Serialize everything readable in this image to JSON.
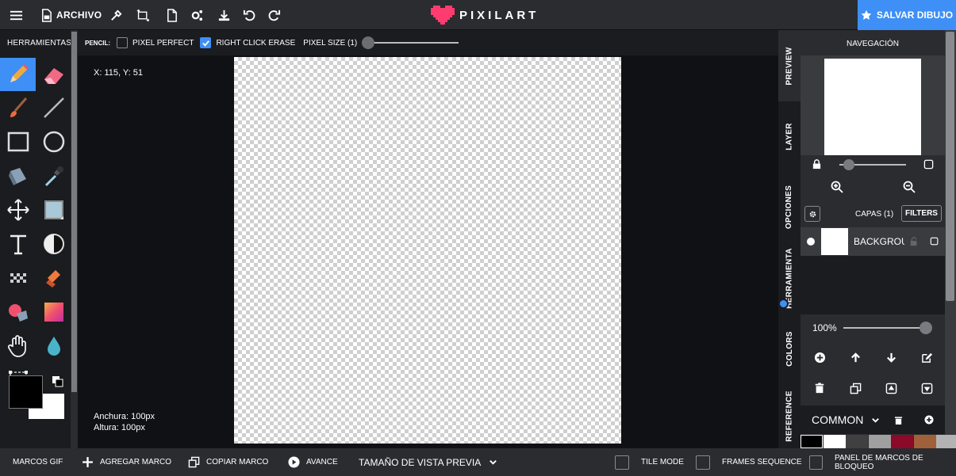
{
  "topbar": {
    "archivo_label": "ARCHIVO",
    "logo_text": "PIXILART",
    "save_label": "SALVAR DIBUJO",
    "icons": [
      "menu-icon",
      "file-icon",
      "eyedropper-icon",
      "resize-icon",
      "new-page-icon",
      "settings-icon",
      "download-icon",
      "undo-icon",
      "redo-icon"
    ]
  },
  "tools": {
    "header": "HERRAMIENTAS",
    "items": [
      "pencil",
      "eraser",
      "brush",
      "line",
      "rectangle",
      "ellipse",
      "bucket",
      "eyedropper",
      "move",
      "select",
      "text",
      "dither",
      "checker",
      "stamp",
      "gradient-bucket",
      "gradient",
      "hand",
      "drop",
      "crop"
    ]
  },
  "options": {
    "tool_label": "PENCIL:",
    "pixel_perfect": "PIXEL PERFECT",
    "pixel_perfect_checked": false,
    "right_click_erase": "RIGHT CLICK ERASE",
    "right_click_erase_checked": true,
    "pixel_size": "PIXEL SIZE (1)"
  },
  "canvas": {
    "coords": "X: 115, Y: 51",
    "width_label": "Anchura: 100px",
    "height_label": "Altura: 100px"
  },
  "side_tabs": [
    "PREVIEW",
    "LAYER",
    "OPCIONES",
    "HERRAMIENTA",
    "COLORS",
    "REFERENCE"
  ],
  "navigation": {
    "title": "NAVEGACIÓN"
  },
  "layers": {
    "title": "CAPAS (1)",
    "filters_label": "FILTERS",
    "items": [
      {
        "name": "BACKGROUND"
      }
    ],
    "opacity": "100%"
  },
  "palette": {
    "name": "COMMON",
    "colors": [
      "#000000",
      "#ffffff",
      "#404040",
      "#a0a0a0",
      "#8b0a2a",
      "#a0603a",
      "#b3b3b3"
    ]
  },
  "bottombar": {
    "frames_label": "MARCOS GIF",
    "add_frame": "AGREGAR MARCO",
    "copy_frame": "COPIAR MARCO",
    "play": "AVANCE",
    "preview_size": "TAMAÑO DE VISTA PREVIA",
    "tile_mode": "TILE MODE",
    "frames_sequence": "FRAMES SEQUENCE",
    "lock_panel": "PANEL DE MARCOS DE BLOQUEO"
  },
  "colors": {
    "accent": "#3e8ff6",
    "logo_heart": "#ff3c6f",
    "primary": "#000000",
    "secondary": "#ffffff"
  }
}
